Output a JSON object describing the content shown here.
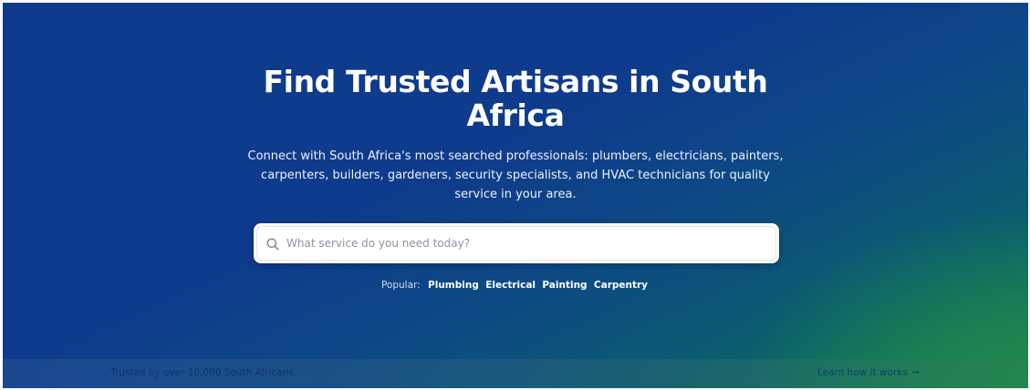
{
  "hero": {
    "title": "Find Trusted Artisans in South Africa",
    "subtitle": "Connect with South Africa's most searched professionals: plumbers, electricians, painters, carpenters, builders, gardeners, security specialists, and HVAC technicians for quality service in your area."
  },
  "search": {
    "placeholder": "What service do you need today?",
    "value": "",
    "icon": "search-icon"
  },
  "popular": {
    "label": "Popular:",
    "tags": [
      "Plumbing",
      "Electrical",
      "Painting",
      "Carpentry"
    ]
  },
  "bottom_bar": {
    "trusted_text": "Trusted by over 10,000 South Africans",
    "learn_link": "Learn how it works",
    "learn_icon": "arrow-right-icon",
    "learn_arrow": "→"
  },
  "colors": {
    "hero_blue": "#0e3b8c",
    "hero_green": "#14795a",
    "text_white": "#ffffff"
  }
}
